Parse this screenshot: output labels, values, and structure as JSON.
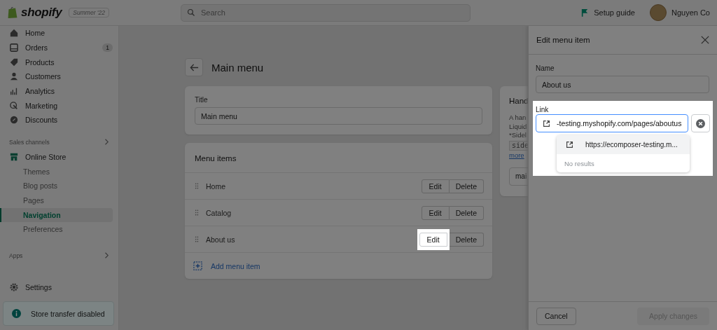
{
  "topbar": {
    "logo": "shopify",
    "edition": "Summer '22",
    "search": {
      "placeholder": "Search"
    },
    "setup_guide": "Setup guide",
    "user": "Nguyen Co"
  },
  "sidebar": {
    "items": [
      {
        "label": "Home",
        "selected": false
      },
      {
        "label": "Orders",
        "selected": false,
        "badge": "1"
      },
      {
        "label": "Products",
        "selected": false
      },
      {
        "label": "Customers",
        "selected": false
      },
      {
        "label": "Analytics",
        "selected": false
      },
      {
        "label": "Marketing",
        "selected": false
      },
      {
        "label": "Discounts",
        "selected": false
      }
    ],
    "sales_channels": {
      "heading": "Sales channels",
      "items": [
        {
          "label": "Online Store",
          "selected": false,
          "children": [
            {
              "label": "Themes",
              "selected": false
            },
            {
              "label": "Blog posts",
              "selected": false
            },
            {
              "label": "Pages",
              "selected": false
            },
            {
              "label": "Navigation",
              "selected": true
            },
            {
              "label": "Preferences",
              "selected": false
            }
          ]
        }
      ]
    },
    "apps": {
      "heading": "Apps"
    },
    "settings": {
      "label": "Settings",
      "selected": false
    },
    "notice": "Store transfer disabled"
  },
  "main": {
    "title": "Main menu",
    "title_card": {
      "label": "Title",
      "value": "Main menu"
    },
    "menu_card": {
      "heading": "Menu items",
      "items": [
        {
          "label": "Home",
          "edit": "Edit",
          "delete": "Delete",
          "highlighted": false
        },
        {
          "label": "Catalog",
          "edit": "Edit",
          "delete": "Delete",
          "highlighted": false
        },
        {
          "label": "About us",
          "edit": "Edit",
          "delete": "Delete",
          "highlighted": true
        }
      ],
      "add": "Add menu item"
    },
    "handle_card": {
      "heading": "Hand",
      "lines": [
        "A han",
        "Liquid",
        "*Sidel"
      ],
      "code": "side",
      "link": "more",
      "value": "mai"
    }
  },
  "panel": {
    "title": "Edit menu item",
    "name": {
      "label": "Name",
      "value": "About us"
    },
    "link": {
      "label": "Link",
      "value": "-testing.myshopify.com/pages/aboutus",
      "highlighted": true,
      "suggestions": [
        {
          "text": "https://ecomposer-testing.m...",
          "selected": true
        }
      ],
      "empty": "No results"
    },
    "cancel": "Cancel",
    "apply": {
      "label": "Apply changes",
      "disabled": true
    }
  }
}
